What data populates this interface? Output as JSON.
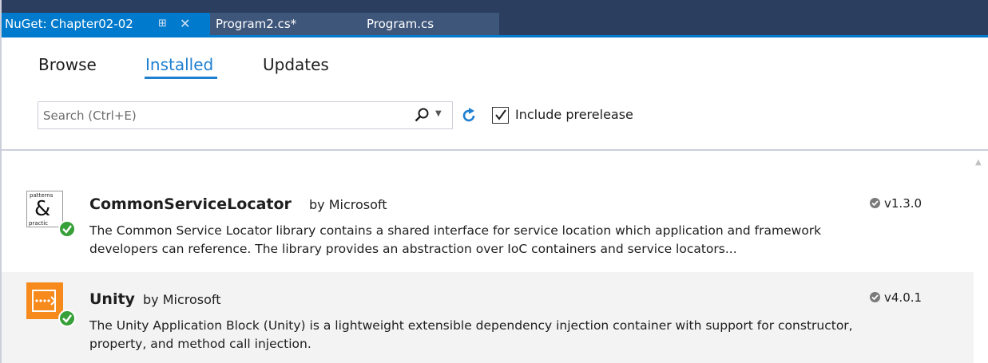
{
  "tabstrip": {
    "tabs": [
      {
        "label": "NuGet: Chapter02-02",
        "active": true,
        "pinned": true
      },
      {
        "label": "Program2.cs*",
        "active": false
      },
      {
        "label": "Program.cs",
        "active": false
      }
    ]
  },
  "nav": {
    "tabs": [
      "Browse",
      "Installed",
      "Updates"
    ],
    "selected": "Installed"
  },
  "search": {
    "placeholder": "Search (Ctrl+E)",
    "value": ""
  },
  "options": {
    "include_prerelease_label": "Include prerelease",
    "include_prerelease_checked": true
  },
  "packages": [
    {
      "name": "CommonServiceLocator",
      "author": "by Microsoft",
      "description": "The Common Service Locator library contains a shared interface for service location which application and framework developers can reference. The library provides an abstraction over IoC containers and service locators...",
      "version": "v1.3.0",
      "icon": "patterns-practices-icon",
      "icon_text_top": "patterns",
      "icon_text_amp": "&",
      "icon_text_bottom": "practic"
    },
    {
      "name": "Unity",
      "author": "by Microsoft",
      "description": "The Unity Application Block (Unity) is a lightweight extensible dependency injection container with support for constructor, property, and method call injection.",
      "version": "v4.0.1",
      "icon": "unity-icon"
    }
  ],
  "colors": {
    "accent": "#007acc",
    "selected_tab_text": "#1f7fd0",
    "installed_badge": "#38a038",
    "unity_orange": "#f78a1d"
  }
}
